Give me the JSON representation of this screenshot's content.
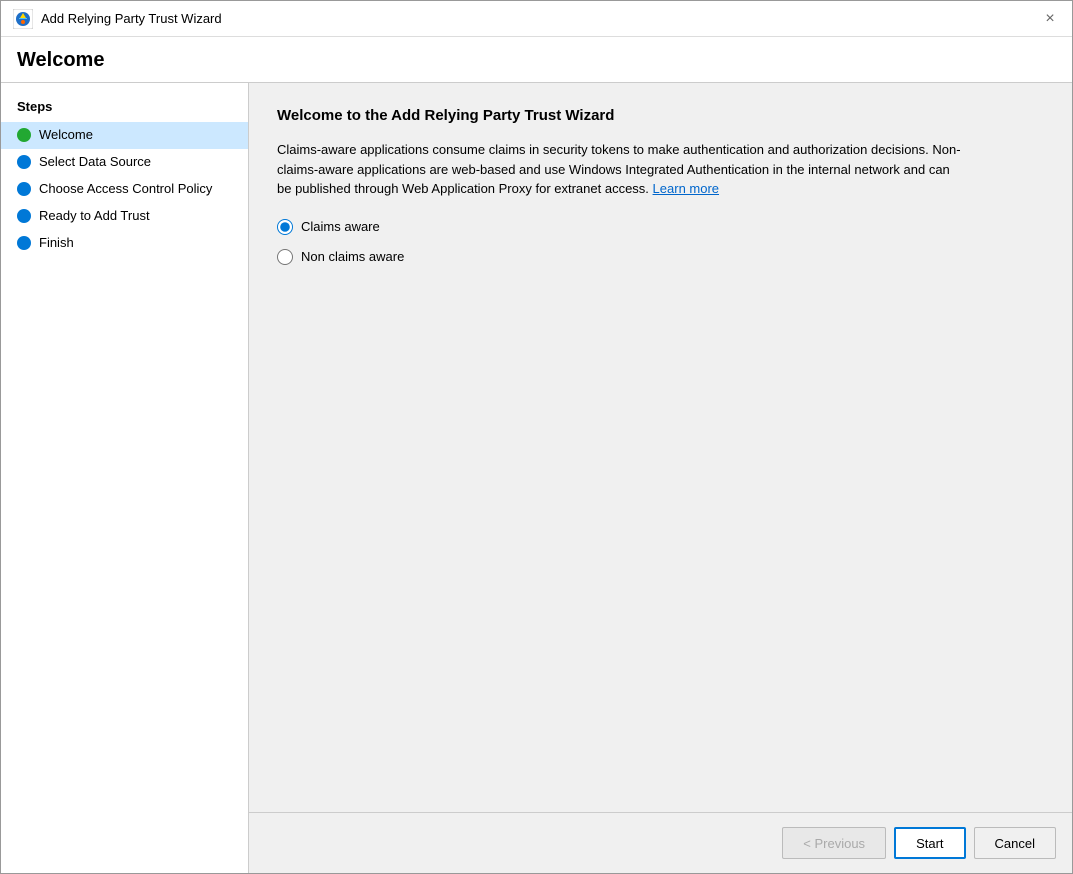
{
  "window": {
    "title": "Add Relying Party Trust Wizard",
    "close_button_label": "×"
  },
  "page_title": "Welcome",
  "sidebar": {
    "steps_label": "Steps",
    "items": [
      {
        "id": "welcome",
        "label": "Welcome",
        "dot_color": "green",
        "active": true
      },
      {
        "id": "select-data-source",
        "label": "Select Data Source",
        "dot_color": "blue",
        "active": false
      },
      {
        "id": "choose-access-control",
        "label": "Choose Access Control Policy",
        "dot_color": "blue",
        "active": false
      },
      {
        "id": "ready-to-add-trust",
        "label": "Ready to Add Trust",
        "dot_color": "blue",
        "active": false
      },
      {
        "id": "finish",
        "label": "Finish",
        "dot_color": "blue",
        "active": false
      }
    ]
  },
  "main": {
    "title": "Welcome to the Add Relying Party Trust Wizard",
    "description_part1": "Claims-aware applications consume claims in security tokens to make authentication and authorization decisions. Non-claims-aware applications are web-based and use Windows Integrated Authentication in the internal network and can be published through Web Application Proxy for extranet access.",
    "learn_more_link": "Learn more",
    "radio_options": [
      {
        "id": "claims-aware",
        "label": "Claims aware",
        "checked": true
      },
      {
        "id": "non-claims-aware",
        "label": "Non claims aware",
        "checked": false
      }
    ]
  },
  "footer": {
    "previous_label": "< Previous",
    "start_label": "Start",
    "cancel_label": "Cancel"
  }
}
